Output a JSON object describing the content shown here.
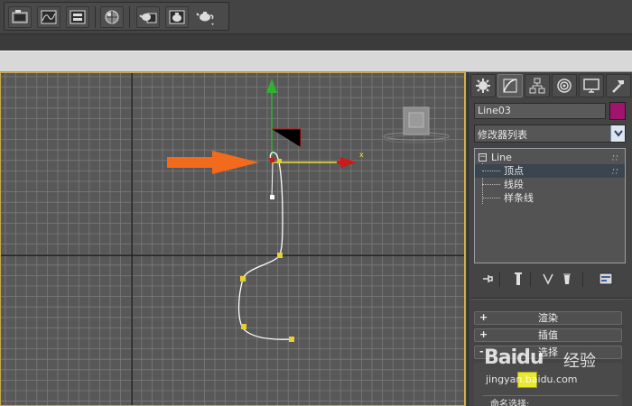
{
  "toolbar": {
    "buttons": [
      {
        "name": "render-setup",
        "icon": "render-setup-icon"
      },
      {
        "name": "curve-editor",
        "icon": "curve-editor-icon"
      },
      {
        "name": "schematic-view",
        "icon": "schematic-view-icon"
      },
      {
        "name": "material-editor",
        "icon": "material-editor-icon"
      },
      {
        "name": "render-frame",
        "icon": "teapot-frame-icon"
      },
      {
        "name": "render-production",
        "icon": "teapot-render-icon"
      },
      {
        "name": "render-dropdown",
        "icon": "teapot-dropdown-icon"
      }
    ]
  },
  "viewport": {
    "axis_label_x": "x",
    "colors": {
      "background": "#585858",
      "grid": "#7a7a7a",
      "grid_major": "#1c1c1c",
      "spline": "#ffffff",
      "vertex": "#e8d030",
      "arrow": "#f26a1b",
      "gizmo_x": "#cc1a1a",
      "gizmo_y": "#2fb32f",
      "border": "#c8a848"
    }
  },
  "command_panel": {
    "tabs": [
      {
        "name": "create",
        "icon": "create-icon",
        "active": false
      },
      {
        "name": "modify",
        "icon": "modify-icon",
        "active": true
      },
      {
        "name": "hierarchy",
        "icon": "hierarchy-icon",
        "active": false
      },
      {
        "name": "motion",
        "icon": "motion-icon",
        "active": false
      },
      {
        "name": "display",
        "icon": "display-icon",
        "active": false
      },
      {
        "name": "utilities",
        "icon": "utilities-icon",
        "active": false
      }
    ],
    "object_name": "Line03",
    "object_color": "#a0146e",
    "modifier_list_label": "修改器列表",
    "stack": {
      "root": "Line",
      "items": [
        {
          "label": "顶点",
          "selected": true
        },
        {
          "label": "线段",
          "selected": false
        },
        {
          "label": "样条线",
          "selected": false
        }
      ]
    },
    "rollouts": [
      {
        "sign": "+",
        "label": "渲染"
      },
      {
        "sign": "+",
        "label": "插值"
      },
      {
        "sign": "-",
        "label": "选择"
      }
    ],
    "named_selection_label": "命名选择:"
  },
  "watermark": {
    "logo": "Baidu",
    "suffix": "经验",
    "url": "jingyan.baidu.com"
  }
}
